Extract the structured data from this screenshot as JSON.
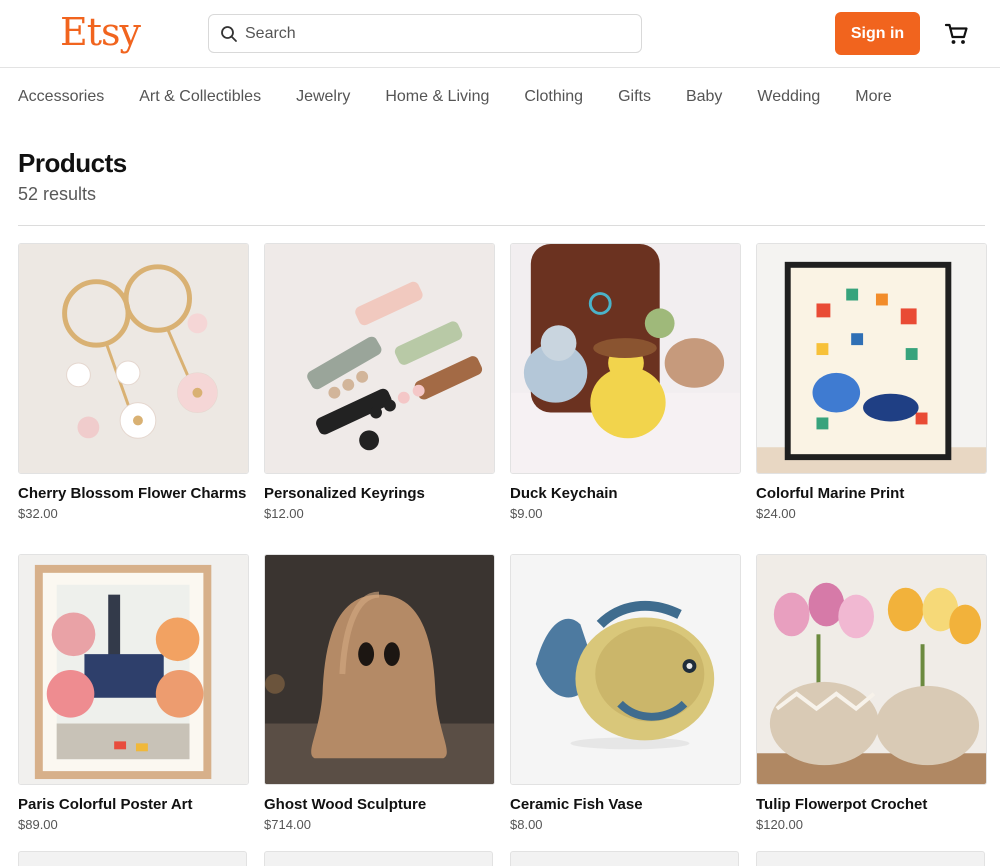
{
  "header": {
    "logo": "Etsy",
    "search_placeholder": "Search",
    "signin_label": "Sign in"
  },
  "nav": [
    "Accessories",
    "Art & Collectibles",
    "Jewelry",
    "Home & Living",
    "Clothing",
    "Gifts",
    "Baby",
    "Wedding",
    "More"
  ],
  "main": {
    "title": "Products",
    "results": "52 results"
  },
  "products": [
    {
      "name": "Cherry Blossom Flower Charms",
      "price": "$32.00"
    },
    {
      "name": "Personalized Keyrings",
      "price": "$12.00"
    },
    {
      "name": "Duck Keychain",
      "price": "$9.00"
    },
    {
      "name": "Colorful Marine Print",
      "price": "$24.00"
    },
    {
      "name": "Paris Colorful Poster Art",
      "price": "$89.00"
    },
    {
      "name": "Ghost Wood Sculpture",
      "price": "$714.00"
    },
    {
      "name": "Ceramic Fish Vase",
      "price": "$8.00"
    },
    {
      "name": "Tulip Flowerpot Crochet",
      "price": "$120.00"
    }
  ],
  "colors": {
    "brand": "#f1641e",
    "text": "#111111",
    "muted": "#555555"
  }
}
